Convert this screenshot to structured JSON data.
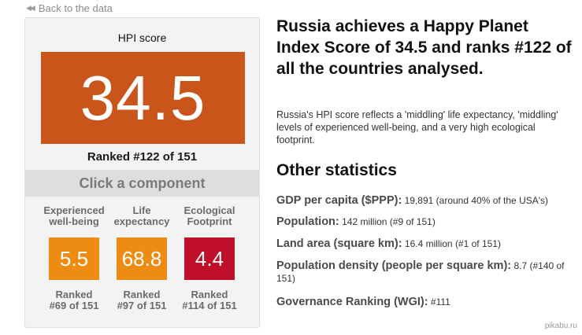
{
  "back_link": {
    "label": "Back to the data",
    "icon": "double-left-arrow-icon"
  },
  "score_panel": {
    "title": "HPI score",
    "score": "34.5",
    "ranked": "Ranked #122 of 151",
    "click_prompt": "Click a component",
    "components": [
      {
        "label": "Experienced well-being",
        "value": "5.5",
        "rank_label": "Ranked",
        "rank": "#69 of 151",
        "color": "#ee8b13"
      },
      {
        "label": "Life expectancy",
        "value": "68.8",
        "rank_label": "Ranked",
        "rank": "#97 of 151",
        "color": "#ee8b13"
      },
      {
        "label": "Ecological Footprint",
        "value": "4.4",
        "rank_label": "Ranked",
        "rank": "#114 of 151",
        "color": "#bf0f2b"
      }
    ],
    "score_color": "#c9551b"
  },
  "headline": "Russia achieves a Happy Planet Index Score of 34.5 and ranks #122 of all the countries analysed.",
  "summary": "Russia's HPI score reflects a 'middling' life expectancy, 'middling' levels of experienced well-being, and a very high ecological footprint.",
  "other_stats": {
    "title": "Other statistics",
    "items": [
      {
        "label": "GDP per capita ($PPP):",
        "value": "19,891 (around 40% of the USA's)"
      },
      {
        "label": "Population:",
        "value": "142 million (#9 of 151)"
      },
      {
        "label": "Land area (square km):",
        "value": "16.4 million (#1 of 151)"
      },
      {
        "label": "Population density (people per square km):",
        "value": "8.7 (#140 of 151)"
      },
      {
        "label": "Governance Ranking (WGI):",
        "value": "#111"
      }
    ]
  },
  "watermark": "pikabu.ru"
}
